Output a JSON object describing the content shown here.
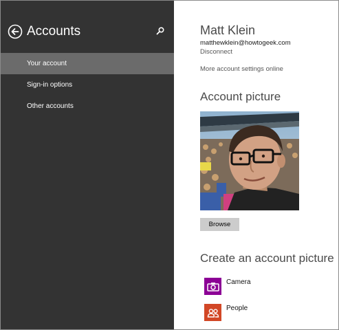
{
  "sidebar": {
    "title": "Accounts",
    "back_icon": "back-arrow-circle-icon",
    "search_icon": "search-icon",
    "items": [
      {
        "label": "Your account",
        "active": true
      },
      {
        "label": "Sign-in options",
        "active": false
      },
      {
        "label": "Other accounts",
        "active": false
      }
    ],
    "colors": {
      "background": "#333333",
      "active_item": "#6b6b6b"
    }
  },
  "account": {
    "name": "Matt Klein",
    "email": "matthewklein@howtogeek.com",
    "disconnect_label": "Disconnect",
    "more_settings_label": "More account settings online"
  },
  "picture": {
    "heading": "Account picture",
    "browse_label": "Browse"
  },
  "create": {
    "heading": "Create an account picture",
    "apps": [
      {
        "label": "Camera",
        "icon": "camera-icon",
        "color": "#8c0095"
      },
      {
        "label": "People",
        "icon": "people-icon",
        "color": "#d24726"
      }
    ]
  }
}
